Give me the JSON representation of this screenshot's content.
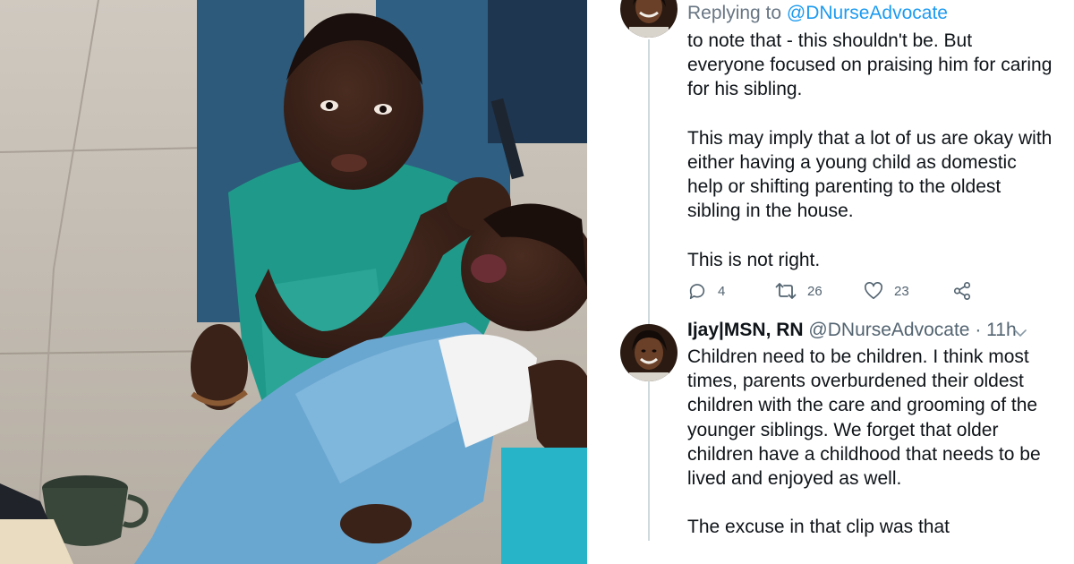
{
  "tweet1": {
    "replying_prefix": "Replying to ",
    "replying_handle": "@DNurseAdvocate",
    "paragraphs": [
      "to note that - this shouldn't be. But everyone focused on praising him for caring for his sibling.",
      "This may imply that a lot of us are okay with either having a young child as domestic help or shifting parenting to the oldest sibling in the house.",
      "This is not right."
    ],
    "actions": {
      "reply_icon": "comment-icon",
      "replies": "4",
      "retweet_icon": "retweet-icon",
      "retweets": "26",
      "like_icon": "heart-icon",
      "likes": "23",
      "share_icon": "share-icon"
    }
  },
  "tweet2": {
    "name": "Ijay|MSN, RN",
    "handle": "@DNurseAdvocate",
    "separator": " · ",
    "time": "11h",
    "menu_icon": "chevron-down-icon",
    "paragraphs": [
      "Children need to be children. I think most times, parents overburdened their oldest children with the care and grooming of the younger siblings. We forget that older children have a childhood that needs to be lived and enjoyed as well.",
      "The excuse in that clip was that"
    ]
  },
  "colors": {
    "link": "#1d9bf0",
    "secondary_text": "#536471",
    "primary_text": "#0f1419",
    "thread_line": "#cfd9de"
  }
}
